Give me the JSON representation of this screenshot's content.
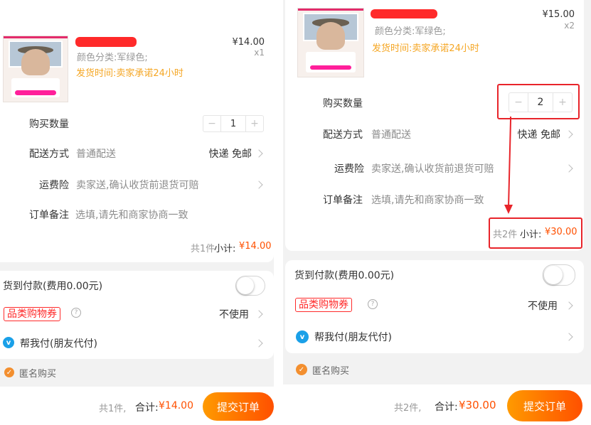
{
  "left": {
    "product": {
      "price": "¥14.00",
      "qty": "x1",
      "variant": "颜色分类:军绿色;",
      "ship_time": "发货时间:卖家承诺24小时"
    },
    "quantity": {
      "label": "购买数量",
      "minus": "−",
      "value": "1",
      "plus": "+"
    },
    "delivery": {
      "label": "配送方式",
      "value": "普通配送",
      "method": "快递 免邮"
    },
    "insurance": {
      "label": "运费险",
      "value": "卖家送,确认收货前退货可赔"
    },
    "note": {
      "label": "订单备注",
      "placeholder": "选填,请先和商家协商一致"
    },
    "subtotal": {
      "count": "共1件",
      "label": "小计:",
      "amount": "¥14.00"
    },
    "cod": {
      "label": "货到付款(费用0.00元)"
    },
    "coupon": {
      "label": "品类购物券",
      "help": "?",
      "value": "不使用"
    },
    "friend_pay": {
      "icon": "v",
      "label": "帮我付(朋友代付)"
    },
    "anonymous": {
      "label": "匿名购买"
    },
    "footer": {
      "count": "共1件,",
      "total_label": "合计:",
      "total": "¥14.00",
      "submit": "提交订单"
    }
  },
  "right": {
    "product": {
      "price": "¥15.00",
      "qty": "x2",
      "variant": "颜色分类:军绿色;",
      "ship_time": "发货时间:卖家承诺24小时"
    },
    "quantity": {
      "label": "购买数量",
      "minus": "−",
      "value": "2",
      "plus": "+"
    },
    "delivery": {
      "label": "配送方式",
      "value": "普通配送",
      "method": "快递 免邮"
    },
    "insurance": {
      "label": "运费险",
      "value": "卖家送,确认收货前退货可赔"
    },
    "note": {
      "label": "订单备注",
      "placeholder": "选填,请先和商家协商一致"
    },
    "subtotal": {
      "count": "共2件",
      "label": "小计:",
      "amount": "¥30.00"
    },
    "cod": {
      "label": "货到付款(费用0.00元)"
    },
    "coupon": {
      "label": "品类购物券",
      "help": "?",
      "value": "不使用"
    },
    "friend_pay": {
      "icon": "v",
      "label": "帮我付(朋友代付)"
    },
    "anonymous": {
      "label": "匿名购买"
    },
    "footer": {
      "count": "共2件,",
      "total_label": "合计:",
      "total": "¥30.00",
      "submit": "提交订单"
    }
  },
  "colors": {
    "accent": "#ff5000",
    "highlight_box": "#e8242a",
    "ship_time": "#f5a623",
    "coupon": "#ff2a2a",
    "pay_icon": "#1aa0e8"
  }
}
